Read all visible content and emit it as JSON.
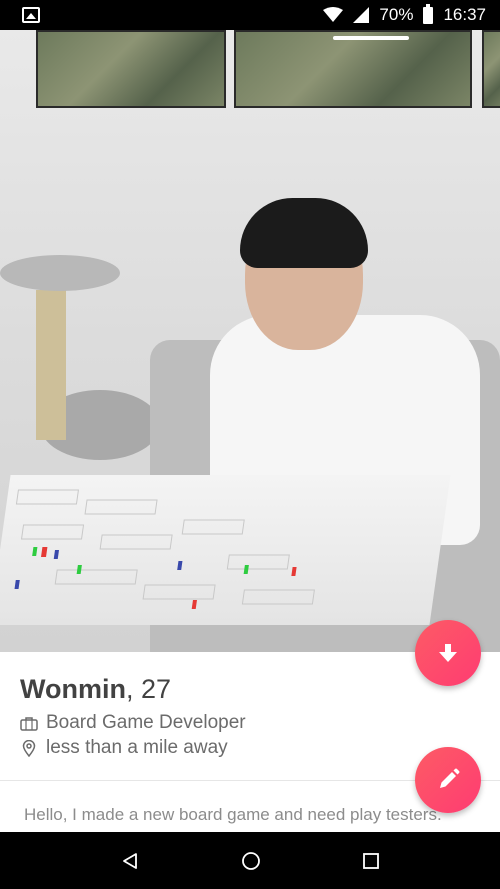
{
  "status_bar": {
    "battery_percent": "70%",
    "time": "16:37",
    "icons": [
      "image-icon",
      "wifi-icon",
      "signal-icon",
      "battery-icon"
    ]
  },
  "profile": {
    "name": "Wonmin",
    "age": ", 27",
    "job": "Board Game Developer",
    "distance": "less than a mile away",
    "bio": "Hello, I made a new board game and need play testers.",
    "photo_description": "photo"
  },
  "actions": {
    "collapse_icon": "arrow-down-icon",
    "edit_icon": "pencil-icon"
  },
  "nav": {
    "icons": [
      "back-icon",
      "home-icon",
      "recents-icon"
    ]
  },
  "colors": {
    "accent": "#fd4f6a",
    "text_primary": "#424242",
    "text_secondary": "#6b6b6b"
  }
}
